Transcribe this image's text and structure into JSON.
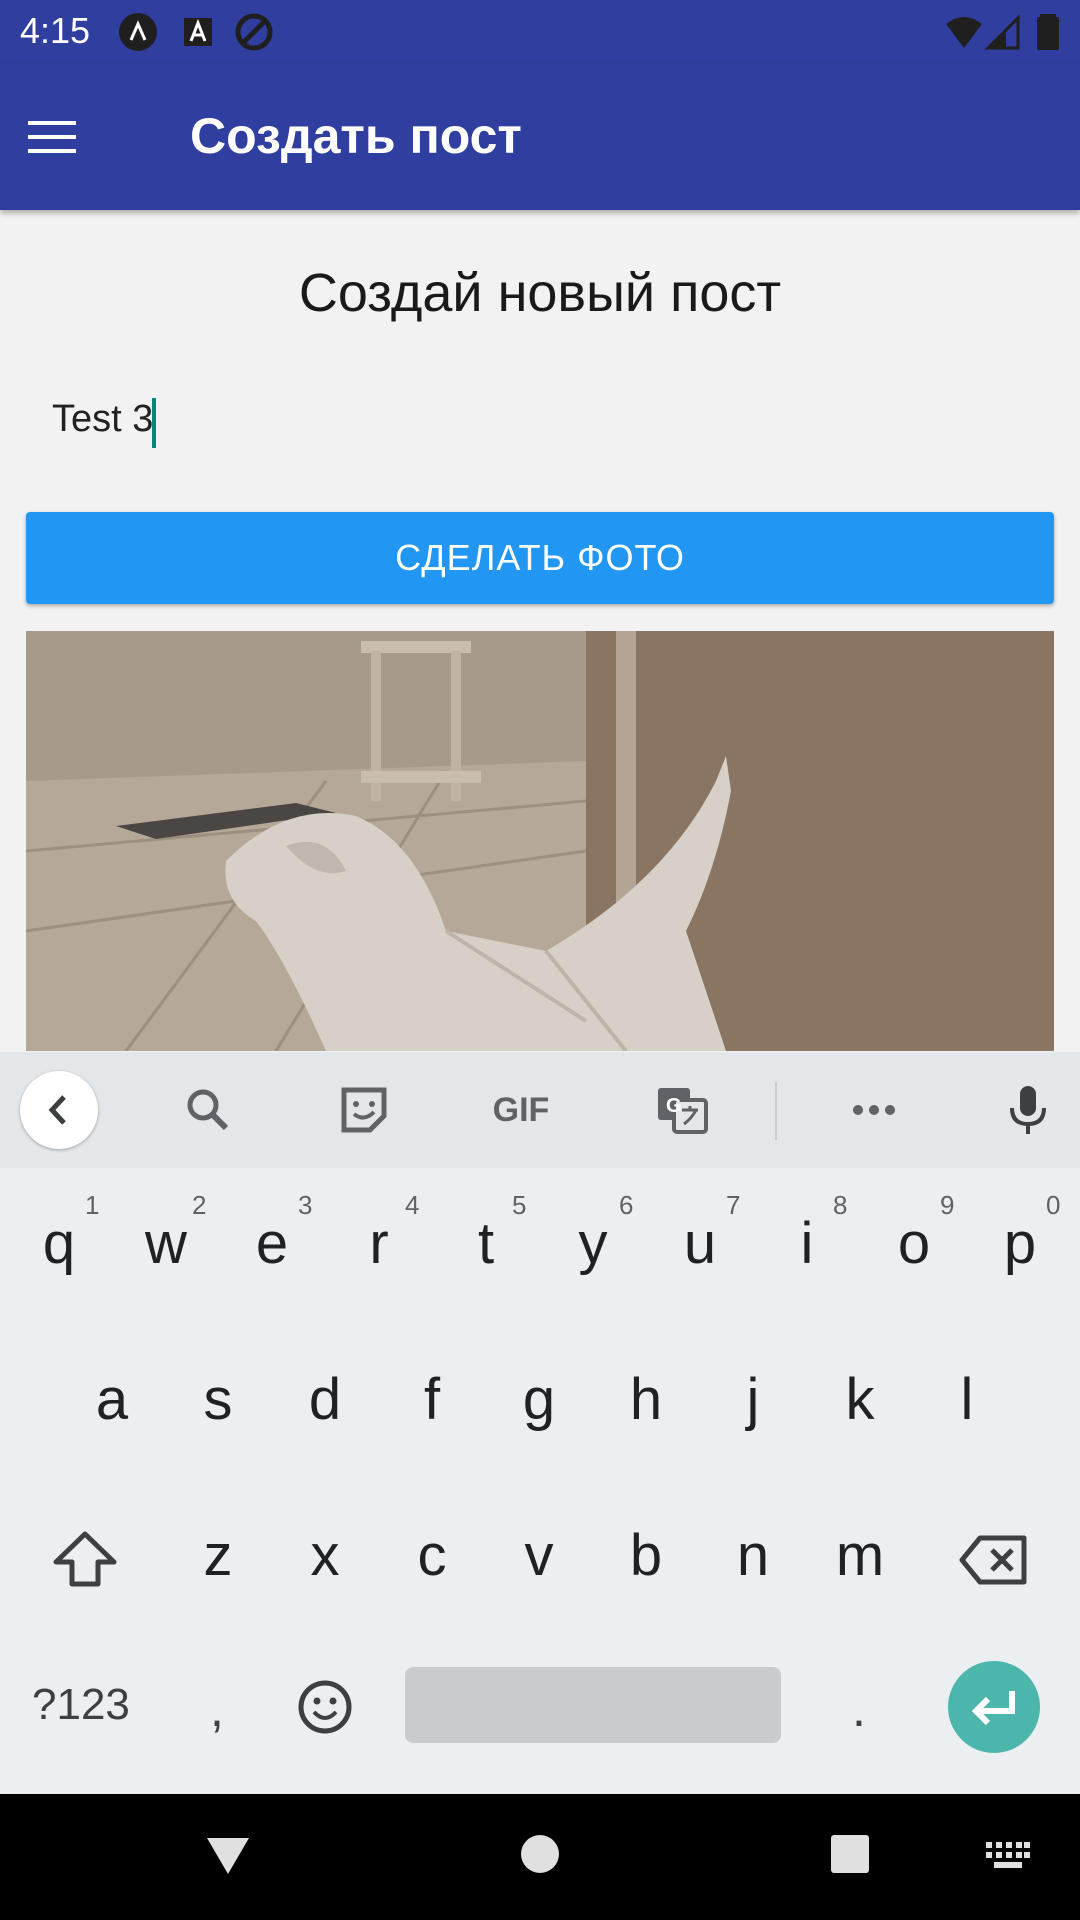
{
  "status_bar": {
    "time": "4:15",
    "icons_left": [
      "assistant-icon",
      "text-a-icon",
      "sync-icon"
    ],
    "icons_right": [
      "wifi-icon",
      "cell-signal-icon",
      "battery-icon"
    ]
  },
  "app_bar": {
    "title": "Создать пост",
    "menu_icon": "hamburger-menu-icon"
  },
  "content": {
    "heading": "Создай новый пост",
    "title_input_value": "Test 3",
    "photo_button_label": "СДЕЛАТЬ ФОТО",
    "photo_description": "photo-preview"
  },
  "keyboard": {
    "toolbar": {
      "gif_label": "GIF",
      "icons": [
        "chevron-left-icon",
        "search-icon",
        "sticker-icon",
        "gif-icon",
        "translate-icon",
        "more-icon",
        "microphone-icon"
      ]
    },
    "row1": [
      {
        "key": "q",
        "num": "1"
      },
      {
        "key": "w",
        "num": "2"
      },
      {
        "key": "e",
        "num": "3"
      },
      {
        "key": "r",
        "num": "4"
      },
      {
        "key": "t",
        "num": "5"
      },
      {
        "key": "y",
        "num": "6"
      },
      {
        "key": "u",
        "num": "7"
      },
      {
        "key": "i",
        "num": "8"
      },
      {
        "key": "o",
        "num": "9"
      },
      {
        "key": "p",
        "num": "0"
      }
    ],
    "row2": [
      "a",
      "s",
      "d",
      "f",
      "g",
      "h",
      "j",
      "k",
      "l"
    ],
    "row3": [
      "z",
      "x",
      "c",
      "v",
      "b",
      "n",
      "m"
    ],
    "symbols_label": "?123",
    "comma": ",",
    "period": "."
  },
  "colors": {
    "app_bar": "#303f9f",
    "button": "#2196f3",
    "enter_key": "#4db6ac",
    "caret": "#00897b"
  }
}
